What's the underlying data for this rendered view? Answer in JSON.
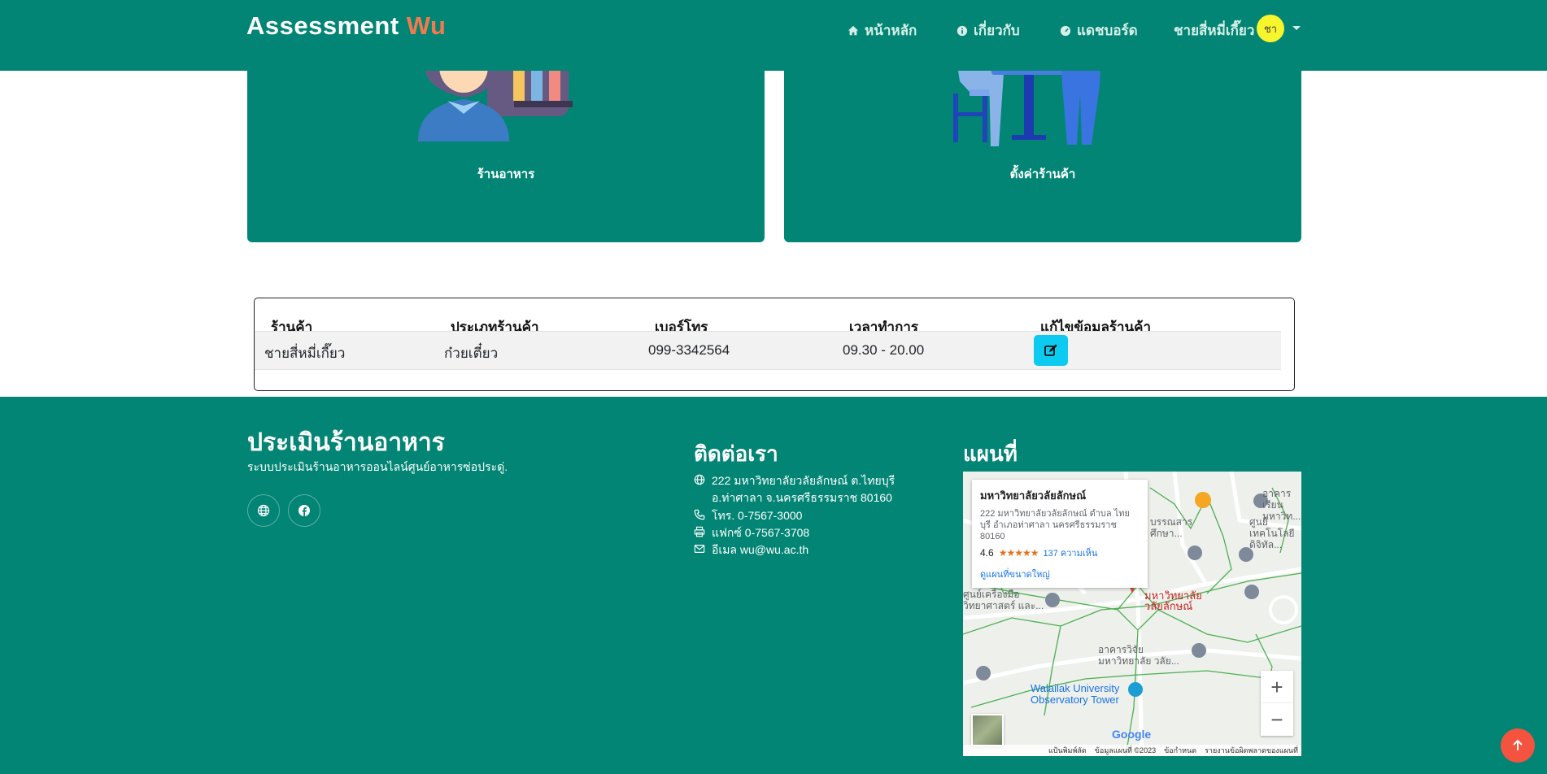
{
  "navbar": {
    "brand_main": "Assessment",
    "brand_accent": "Wu",
    "home": "หน้าหลัก",
    "about": "เกี่ยวกับ",
    "dashboard": "แดชบอร์ด",
    "user_name": "ชายสี่หมี่เกี๊ยว",
    "avatar_text": "ชา"
  },
  "cards": [
    {
      "label": "ร้านอาหาร"
    },
    {
      "label": "ตั้งค่าร้านค้า"
    }
  ],
  "table": {
    "headers": [
      "ร้านค้า",
      "ประเภทร้านค้า",
      "เบอร์โทร",
      "เวลาทำการ",
      "แก้ไขข้อมูลร้านค้า"
    ],
    "rows": [
      {
        "shop": "ชายสี่หมี่เกี๊ยว",
        "type": "ก๋วยเตี๋ยว",
        "phone": "099-3342564",
        "hours": "09.30 - 20.00"
      }
    ]
  },
  "footer": {
    "title": "ประเมินร้านอาหาร",
    "description": "ระบบประเมินร้านอาหารออนไลน์ศูนย์อาหารซ่อประดู่.",
    "contact_title": "ติดต่อเรา",
    "address": "222 มหาวิทยาลัยวลัยลักษณ์ ต.ไทยบุรี อ.ท่าศาลา จ.นครศรีธรรมราช 80160",
    "phone": "โทร. 0-7567-3000",
    "fax": "แฟกซ์ 0-7567-3708",
    "email": "อีเมล wu@wu.ac.th",
    "map_title": "แผนที่"
  },
  "map": {
    "place_name": "มหาวิทยาลัยวลัยลักษณ์",
    "place_address": "222 มหาวิทยาลัยวลัยลักษณ์ ตำบล ไทยบุรี อำเภอท่าศาลา นครศรีธรรมราช 80160",
    "rating": "4.6",
    "stars": "★★★★★",
    "reviews": "137 ความเห็น",
    "view_larger": "ดูแผนที่ขนาดใหญ่",
    "pin_label": "มหาวิทยาลัย วลัยลักษณ์",
    "tower_label": "Walailak University Observatory Tower",
    "label_research": "อาคารวิจัย มหาวิทยาลัย วลัย...",
    "label_tools": "ศูนย์เครื่องมือ วิทยาศาสตร์ และ...",
    "label_edu": "บรรณสาร ศึกษา...",
    "label_tech": "ศูนย์เทคโนโลยี ดิจิทัล...",
    "label_building": "อาคารเรียน มหาวิท...",
    "zoom_in": "+",
    "zoom_out": "−",
    "google": "Google",
    "attrib_shortcuts": "แป้นพิมพ์ลัด",
    "attrib_data": "ข้อมูลแผนที่ ©2023",
    "attrib_terms": "ข้อกำหนด",
    "attrib_report": "รายงานข้อผิดพลาดของแผนที่"
  }
}
